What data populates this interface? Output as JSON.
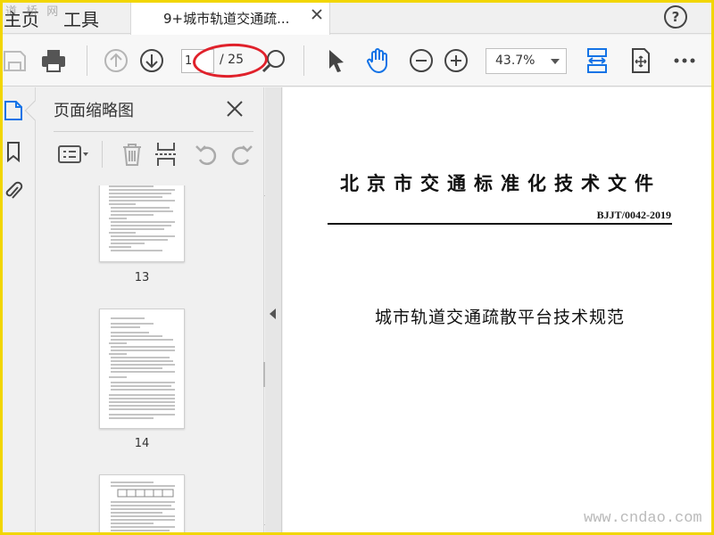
{
  "tabbar": {
    "home_label": "主页",
    "tools_label": "工具",
    "watermark": "道 桥 网",
    "document_tab_title": "9+城市轨道交通疏...",
    "help_label": "?"
  },
  "toolbar": {
    "current_page": "1",
    "total_pages": "/ 25",
    "zoom_value": "43.7%",
    "icons": [
      "save-icon",
      "print-icon",
      "previous-page-icon",
      "next-page-icon",
      "zoom-in-icon",
      "select-cursor-icon",
      "hand-tool-icon",
      "zoom-out-icon",
      "zoom-in-icon",
      "fit-page-icon",
      "scrolling-mode-icon",
      "more-icon"
    ]
  },
  "left_rail": {
    "icons": [
      "page-thumbnails-icon",
      "bookmarks-icon",
      "attachments-icon"
    ]
  },
  "thumbnail_panel": {
    "title": "页面缩略图",
    "thumbnails": [
      {
        "label": "13"
      },
      {
        "label": "14"
      }
    ]
  },
  "document": {
    "organization_header": "北京市交通标准化技术文件",
    "standard_code": "BJJT/0042-2019",
    "title": "城市轨道交通疏散平台技术规范"
  },
  "watermark_bottom": "www.cndao.com",
  "colors": {
    "highlight_ellipse": "#e0212b",
    "frame": "#f2d600",
    "accent_blue": "#1473e6"
  }
}
